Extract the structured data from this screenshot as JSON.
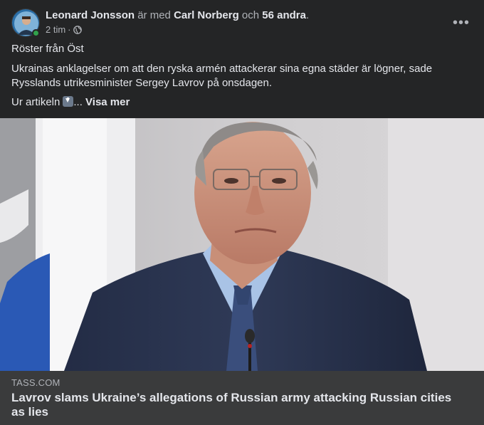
{
  "post": {
    "author": "Leonard Jonsson",
    "with_text": "är med",
    "tagged": "Carl Norberg",
    "and_text": "och",
    "others": "56 andra",
    "period": ".",
    "time": "2 tim",
    "separator": "·",
    "audience_icon": "globe-icon",
    "more_icon": "more-options-icon",
    "line1": "Röster från Öst",
    "line2": "Ukrainas anklagelser om att den ryska armén attackerar sina egna städer är lögner, sade Rysslands utrikesminister Sergey Lavrov på onsdagen.",
    "line3_prefix": "Ur artikeln",
    "line3_emoji": "down-arrow-emoji",
    "ellipsis": "...",
    "see_more": "Visa mer"
  },
  "link": {
    "domain": "TASS.COM",
    "headline": "Lavrov slams Ukraine’s allegations of Russian army attacking Russian cities as lies"
  },
  "colors": {
    "background": "#242526",
    "preview_background": "#3a3b3c",
    "primary_text": "#e4e6eb",
    "secondary_text": "#b0b3b8",
    "online": "#31a24c"
  }
}
